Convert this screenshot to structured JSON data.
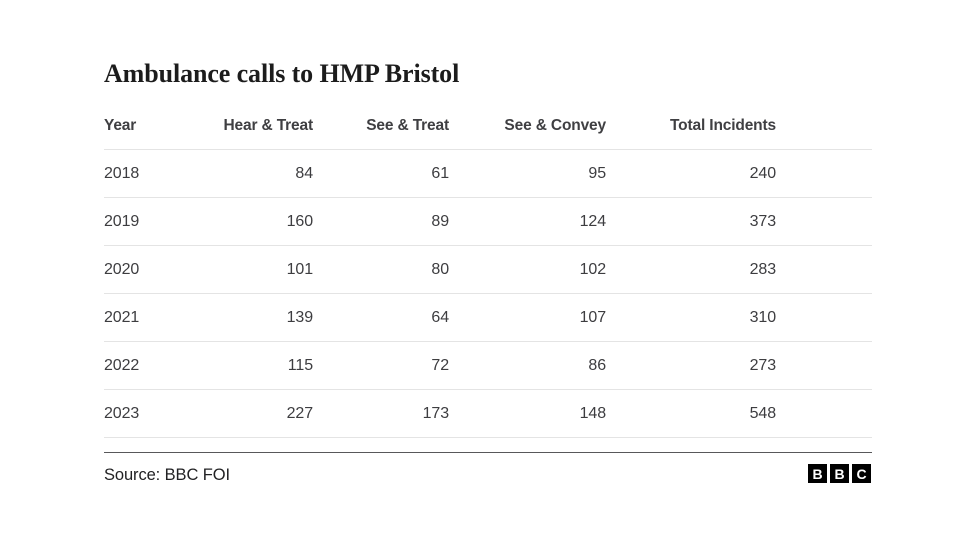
{
  "title": "Ambulance calls to HMP Bristol",
  "source": {
    "label": "Source: BBC FOI",
    "logo": {
      "b1": "B",
      "b2": "B",
      "c": "C"
    }
  },
  "colors": {
    "background": "#ffffff",
    "title": "#1c1c1c",
    "header_text": "#3f3f42",
    "cell_text": "#3d3d40",
    "row_rule": "#e4e4e4",
    "footer_rule": "#58585a",
    "logo_block": "#000000",
    "logo_letter": "#ffffff"
  },
  "chart_data": {
    "type": "table",
    "title": "Ambulance calls to HMP Bristol",
    "xlabel": "",
    "ylabel": "",
    "source": "Source: BBC FOI",
    "columns": [
      "Year",
      "Hear & Treat",
      "See & Treat",
      "See & Convey",
      "Total Incidents"
    ],
    "categories": [
      "2018",
      "2019",
      "2020",
      "2021",
      "2022",
      "2023"
    ],
    "series": [
      {
        "name": "Hear & Treat",
        "values": [
          84,
          160,
          101,
          139,
          115,
          227
        ]
      },
      {
        "name": "See & Treat",
        "values": [
          61,
          89,
          80,
          64,
          72,
          173
        ]
      },
      {
        "name": "See & Convey",
        "values": [
          95,
          124,
          102,
          107,
          86,
          148
        ]
      },
      {
        "name": "Total Incidents",
        "values": [
          240,
          373,
          283,
          310,
          273,
          548
        ]
      }
    ],
    "rows": [
      {
        "year": "2018",
        "hear_treat": "84",
        "see_treat": "61",
        "see_convey": "95",
        "total": "240"
      },
      {
        "year": "2019",
        "hear_treat": "160",
        "see_treat": "89",
        "see_convey": "124",
        "total": "373"
      },
      {
        "year": "2020",
        "hear_treat": "101",
        "see_treat": "80",
        "see_convey": "102",
        "total": "283"
      },
      {
        "year": "2021",
        "hear_treat": "139",
        "see_treat": "64",
        "see_convey": "107",
        "total": "310"
      },
      {
        "year": "2022",
        "hear_treat": "115",
        "see_treat": "72",
        "see_convey": "86",
        "total": "273"
      },
      {
        "year": "2023",
        "hear_treat": "227",
        "see_treat": "173",
        "see_convey": "148",
        "total": "548"
      }
    ]
  }
}
